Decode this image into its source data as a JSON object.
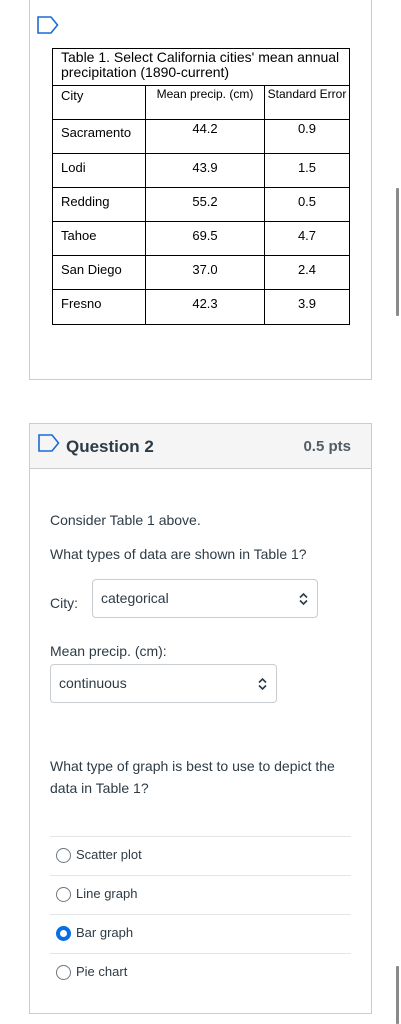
{
  "table": {
    "caption": "Table 1. Select California cities' mean annual precipitation (1890-current)",
    "headers": [
      "City",
      "Mean precip. (cm)",
      "Standard Error"
    ],
    "rows": [
      [
        "Sacramento",
        "44.2",
        "0.9"
      ],
      [
        "Lodi",
        "43.9",
        "1.5"
      ],
      [
        "Redding",
        "55.2",
        "0.5"
      ],
      [
        "Tahoe",
        "69.5",
        "4.7"
      ],
      [
        "San Diego",
        "37.0",
        "2.4"
      ],
      [
        "Fresno",
        "42.3",
        "3.9"
      ]
    ]
  },
  "question": {
    "title": "Question 2",
    "points": "0.5 pts",
    "prompt1": "Consider Table 1 above.",
    "prompt2": "What types of data are shown in Table 1?",
    "city_label": "City:",
    "city_value": "categorical",
    "mean_label": "Mean precip. (cm):",
    "mean_value": "continuous",
    "prompt3": "What type of graph is best to use to depict the data in Table 1?",
    "answers": [
      {
        "label": "Scatter plot",
        "selected": false
      },
      {
        "label": "Line graph",
        "selected": false
      },
      {
        "label": "Bar graph",
        "selected": true
      },
      {
        "label": "Pie chart",
        "selected": false
      }
    ]
  },
  "icons": {
    "flag": "bookmark-flag-icon",
    "select": "chevron-up-down-icon"
  },
  "colors": {
    "accent": "#0770e0",
    "flag": "#1b6cd6",
    "border": "#c7cdd1"
  }
}
